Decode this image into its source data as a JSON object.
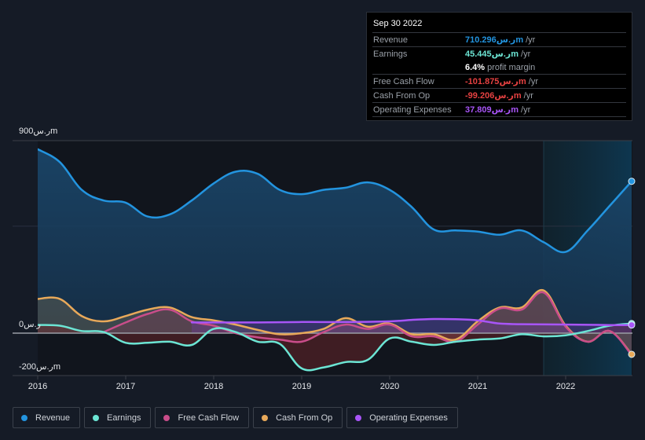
{
  "tooltip": {
    "date": "Sep 30 2022",
    "rows": [
      {
        "label": "Revenue",
        "value": "710.296ر.سm",
        "unit": "/yr",
        "color": "#2394df"
      },
      {
        "label": "Earnings",
        "value": "45.445ر.سm",
        "unit": "/yr",
        "color": "#6ce5d4"
      },
      {
        "label": "",
        "value": "6.4%",
        "unit": "profit margin",
        "color": "#ffffff"
      },
      {
        "label": "Free Cash Flow",
        "value": "-101.875ر.سm",
        "unit": "/yr",
        "color": "#e64141"
      },
      {
        "label": "Cash From Op",
        "value": "-99.206ر.سm",
        "unit": "/yr",
        "color": "#e64141"
      },
      {
        "label": "Operating Expenses",
        "value": "37.809ر.سm",
        "unit": "/yr",
        "color": "#a855f7"
      }
    ]
  },
  "legend": [
    {
      "label": "Revenue",
      "color": "#2394df"
    },
    {
      "label": "Earnings",
      "color": "#6ce5d4"
    },
    {
      "label": "Free Cash Flow",
      "color": "#c94d8a"
    },
    {
      "label": "Cash From Op",
      "color": "#e8a95a"
    },
    {
      "label": "Operating Expenses",
      "color": "#a855f7"
    }
  ],
  "chart_data": {
    "type": "line",
    "title": "",
    "xlabel": "",
    "ylabel": "",
    "y_tick_labels": [
      "900ر.سm",
      "0ر.س",
      "-200ر.سm"
    ],
    "y_ticks": [
      900,
      0,
      -200
    ],
    "ylim": [
      -200,
      900
    ],
    "xlim": [
      2015.85,
      2022.75
    ],
    "x_tick_labels": [
      "2016",
      "2017",
      "2018",
      "2019",
      "2020",
      "2021",
      "2022"
    ],
    "x_ticks": [
      2016,
      2017,
      2018,
      2019,
      2020,
      2021,
      2022
    ],
    "highlight_from": 2021.75,
    "grid": true,
    "legend_position": "bottom",
    "series": [
      {
        "name": "Revenue",
        "color": "#2394df",
        "x": [
          2016.0,
          2016.25,
          2016.5,
          2016.75,
          2017.0,
          2017.25,
          2017.5,
          2017.75,
          2018.0,
          2018.25,
          2018.5,
          2018.75,
          2019.0,
          2019.25,
          2019.5,
          2019.75,
          2020.0,
          2020.25,
          2020.5,
          2020.75,
          2021.0,
          2021.25,
          2021.5,
          2021.75,
          2022.0,
          2022.25,
          2022.5,
          2022.75
        ],
        "y": [
          860,
          800,
          670,
          620,
          610,
          545,
          555,
          620,
          700,
          755,
          745,
          670,
          650,
          670,
          680,
          705,
          670,
          590,
          485,
          480,
          475,
          460,
          480,
          425,
          380,
          480,
          595,
          710
        ]
      },
      {
        "name": "Earnings",
        "color": "#6ce5d4",
        "x": [
          2016.0,
          2016.25,
          2016.5,
          2016.75,
          2017.0,
          2017.25,
          2017.5,
          2017.75,
          2018.0,
          2018.25,
          2018.5,
          2018.75,
          2019.0,
          2019.25,
          2019.5,
          2019.75,
          2020.0,
          2020.25,
          2020.5,
          2020.75,
          2021.0,
          2021.25,
          2021.5,
          2021.75,
          2022.0,
          2022.25,
          2022.5,
          2022.75
        ],
        "y": [
          38,
          35,
          10,
          5,
          -45,
          -45,
          -40,
          -55,
          20,
          5,
          -40,
          -50,
          -165,
          -160,
          -135,
          -125,
          -25,
          -40,
          -55,
          -40,
          -30,
          -25,
          -5,
          -15,
          -10,
          10,
          35,
          45
        ]
      },
      {
        "name": "Free Cash Flow",
        "color": "#c94d8a",
        "x": [
          2016.75,
          2017.0,
          2017.25,
          2017.5,
          2017.75,
          2018.0,
          2018.25,
          2018.5,
          2018.75,
          2019.0,
          2019.25,
          2019.5,
          2019.75,
          2020.0,
          2020.25,
          2020.5,
          2020.75,
          2021.0,
          2021.25,
          2021.5,
          2021.75,
          2022.0,
          2022.25,
          2022.5,
          2022.75
        ],
        "y": [
          5,
          50,
          90,
          110,
          55,
          35,
          0,
          -20,
          -30,
          -40,
          5,
          40,
          20,
          40,
          -15,
          -15,
          -40,
          40,
          115,
          110,
          190,
          30,
          -40,
          10,
          -102
        ]
      },
      {
        "name": "Cash From Op",
        "color": "#e8a95a",
        "x": [
          2016.0,
          2016.25,
          2016.5,
          2016.75,
          2017.0,
          2017.25,
          2017.5,
          2017.75,
          2018.0,
          2018.25,
          2018.5,
          2018.75,
          2019.0,
          2019.25,
          2019.5,
          2019.75,
          2020.0,
          2020.25,
          2020.5,
          2020.75,
          2021.0,
          2021.25,
          2021.5,
          2021.75,
          2022.0,
          2022.25,
          2022.5,
          2022.75
        ],
        "y": [
          160,
          160,
          80,
          55,
          80,
          110,
          120,
          75,
          60,
          40,
          15,
          -5,
          0,
          20,
          70,
          30,
          45,
          -5,
          -5,
          -30,
          55,
          120,
          120,
          200,
          35,
          -40,
          10,
          -99
        ]
      },
      {
        "name": "Operating Expenses",
        "color": "#a855f7",
        "x": [
          2017.75,
          2018.0,
          2018.5,
          2019.0,
          2019.5,
          2020.0,
          2020.25,
          2020.5,
          2020.75,
          2021.0,
          2021.25,
          2021.5,
          2022.0,
          2022.5,
          2022.75
        ],
        "y": [
          50,
          50,
          50,
          52,
          52,
          55,
          62,
          66,
          65,
          60,
          45,
          42,
          40,
          38,
          38
        ]
      }
    ]
  }
}
